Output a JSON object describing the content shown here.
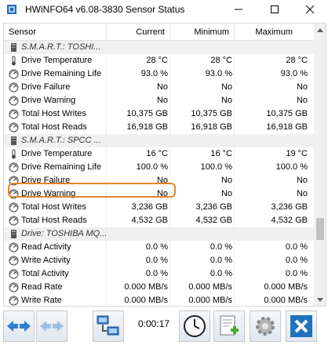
{
  "window": {
    "title": "HWiNFO64 v6.08-3830 Sensor Status",
    "minimize_label": "─",
    "maximize_label": "☐",
    "close_label": "✕"
  },
  "table": {
    "columns": [
      "Sensor",
      "Current",
      "Minimum",
      "Maximum"
    ],
    "rows": [
      {
        "type": "group",
        "icon": "drive-group-icon",
        "name": "S.M.A.R.T.: TOSHI...",
        "current": "",
        "minimum": "",
        "maximum": ""
      },
      {
        "type": "sensor",
        "icon": "thermometer-icon",
        "name": "Drive Temperature",
        "current": "28 °C",
        "minimum": "28 °C",
        "maximum": "28 °C"
      },
      {
        "type": "sensor",
        "icon": "gauge-icon",
        "name": "Drive Remaining Life",
        "current": "93.0 %",
        "minimum": "93.0 %",
        "maximum": "93.0 %"
      },
      {
        "type": "sensor",
        "icon": "gauge-icon",
        "name": "Drive Failure",
        "current": "No",
        "minimum": "No",
        "maximum": "No"
      },
      {
        "type": "sensor",
        "icon": "gauge-icon",
        "name": "Drive Warning",
        "current": "No",
        "minimum": "No",
        "maximum": "No"
      },
      {
        "type": "sensor",
        "icon": "gauge-icon",
        "name": "Total Host Writes",
        "current": "10,375 GB",
        "minimum": "10,375 GB",
        "maximum": "10,375 GB"
      },
      {
        "type": "sensor",
        "icon": "gauge-icon",
        "name": "Total Host Reads",
        "current": "16,918 GB",
        "minimum": "16,918 GB",
        "maximum": "16,918 GB"
      },
      {
        "type": "group",
        "icon": "drive-group-icon",
        "name": "S.M.A.R.T.: SPCC ...",
        "current": "",
        "minimum": "",
        "maximum": ""
      },
      {
        "type": "sensor",
        "icon": "thermometer-icon",
        "name": "Drive Temperature",
        "current": "16 °C",
        "minimum": "16 °C",
        "maximum": "19 °C"
      },
      {
        "type": "sensor",
        "icon": "gauge-icon",
        "name": "Drive Remaining Life",
        "current": "100.0 %",
        "minimum": "100.0 %",
        "maximum": "100.0 %"
      },
      {
        "type": "sensor",
        "icon": "gauge-icon",
        "name": "Drive Failure",
        "current": "No",
        "minimum": "No",
        "maximum": "No"
      },
      {
        "type": "sensor",
        "icon": "gauge-icon",
        "name": "Drive Warning",
        "current": "No",
        "minimum": "No",
        "maximum": "No"
      },
      {
        "type": "sensor",
        "icon": "gauge-icon",
        "name": "Total Host Writes",
        "current": "3,236 GB",
        "minimum": "3,236 GB",
        "maximum": "3,236 GB"
      },
      {
        "type": "sensor",
        "icon": "gauge-icon",
        "name": "Total Host Reads",
        "current": "4,532 GB",
        "minimum": "4,532 GB",
        "maximum": "4,532 GB"
      },
      {
        "type": "group",
        "icon": "drive-group-icon",
        "name": "Drive: TOSHIBA MQ...",
        "current": "",
        "minimum": "",
        "maximum": ""
      },
      {
        "type": "sensor",
        "icon": "gauge-icon",
        "name": "Read Activity",
        "current": "0.0 %",
        "minimum": "0.0 %",
        "maximum": "0.0 %"
      },
      {
        "type": "sensor",
        "icon": "gauge-icon",
        "name": "Write Activity",
        "current": "0.0 %",
        "minimum": "0.0 %",
        "maximum": "0.0 %"
      },
      {
        "type": "sensor",
        "icon": "gauge-icon",
        "name": "Total Activity",
        "current": "0.0 %",
        "minimum": "0.0 %",
        "maximum": "0.0 %"
      },
      {
        "type": "sensor",
        "icon": "gauge-icon",
        "name": "Read Rate",
        "current": "0.000 MB/s",
        "minimum": "0.000 MB/s",
        "maximum": "0.000 MB/s"
      },
      {
        "type": "sensor",
        "icon": "gauge-icon",
        "name": "Write Rate",
        "current": "0.000 MB/s",
        "minimum": "0.000 MB/s",
        "maximum": "0.000 MB/s"
      }
    ],
    "highlighted_row_index": 9
  },
  "toolbar": {
    "elapsed": "0:00:17",
    "buttons": [
      "arrows-left-right-icon",
      "arrows-disabled-icon",
      "network-computers-icon",
      "clock-icon",
      "add-report-icon",
      "settings-gear-icon",
      "close-x-icon"
    ]
  },
  "colors": {
    "highlight": "#e3862d",
    "close_button": "#1e73be",
    "group_row_bg": "#f0f0f0"
  }
}
